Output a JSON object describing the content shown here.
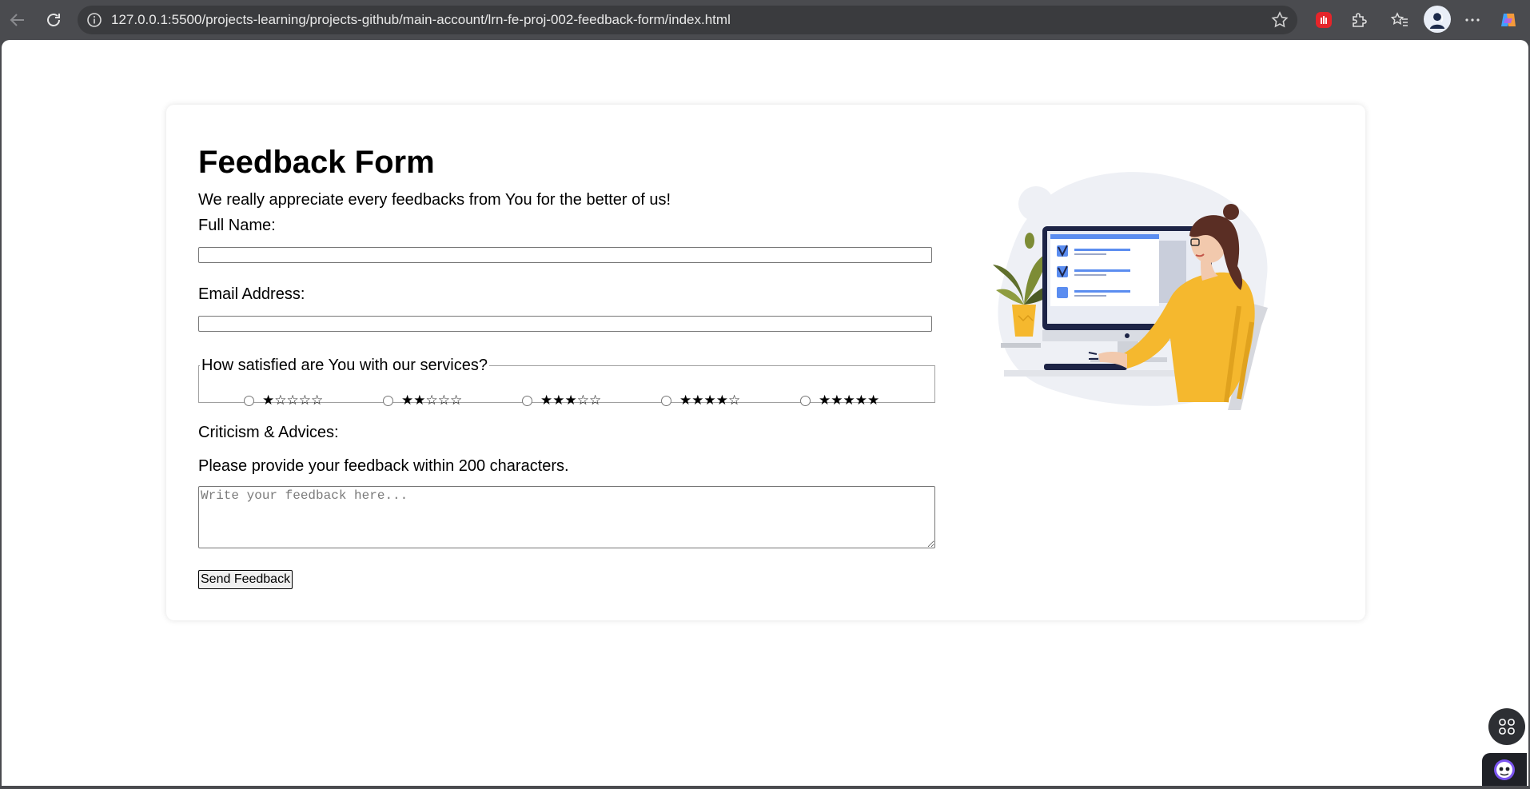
{
  "browser": {
    "url": "127.0.0.1:5500/projects-learning/projects-github/main-account/lrn-fe-proj-002-feedback-form/index.html",
    "icons": [
      "back-icon",
      "reload-icon",
      "info-icon",
      "favorite-star-icon",
      "extension-red-icon",
      "extensions-puzzle-icon",
      "favorites-icon",
      "profile-avatar",
      "more-menu-icon",
      "copilot-icon"
    ]
  },
  "form": {
    "title": "Feedback Form",
    "subtitle": "We really appreciate every feedbacks from You for the better of us!",
    "full_name_label": "Full Name:",
    "full_name_value": "",
    "email_label": "Email Address:",
    "email_value": "",
    "rating_legend": "How satisfied are You with our services?",
    "rating_options": [
      {
        "stars": "★☆☆☆☆",
        "value": 1
      },
      {
        "stars": "★★☆☆☆",
        "value": 2
      },
      {
        "stars": "★★★☆☆",
        "value": 3
      },
      {
        "stars": "★★★★☆",
        "value": 4
      },
      {
        "stars": "★★★★★",
        "value": 5
      }
    ],
    "criticism_label": "Criticism & Advices:",
    "criticism_hint": "Please provide your feedback within 200 characters.",
    "feedback_placeholder": "Write your feedback here...",
    "feedback_value": "",
    "submit_label": "Send Feedback"
  },
  "colors": {
    "chrome": "#4a4b4f",
    "page_bg": "#ffffff",
    "accent_yellow": "#f5b82e",
    "monitor_navy": "#1d2446",
    "check_blue": "#5b8df0"
  }
}
